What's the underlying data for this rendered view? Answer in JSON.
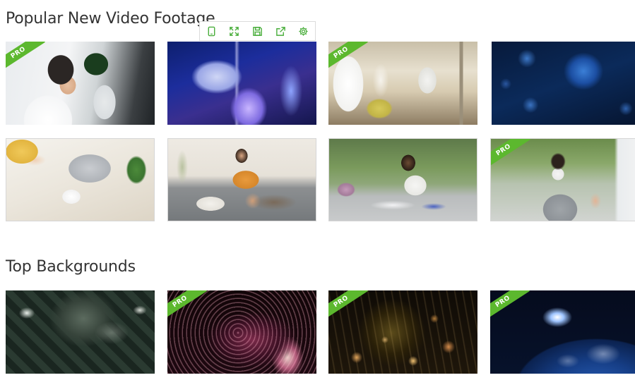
{
  "sections": [
    {
      "title": "Popular New Video Footage"
    },
    {
      "title": "Top Backgrounds"
    }
  ],
  "pro_label": "PRO",
  "toolbar": {
    "buttons": [
      {
        "icon": "tablet-icon"
      },
      {
        "icon": "expand-icon"
      },
      {
        "icon": "save-icon"
      },
      {
        "icon": "share-icon"
      },
      {
        "icon": "gear-icon"
      }
    ]
  },
  "colors": {
    "accent": "#5cb82e",
    "title_text": "#333333"
  }
}
